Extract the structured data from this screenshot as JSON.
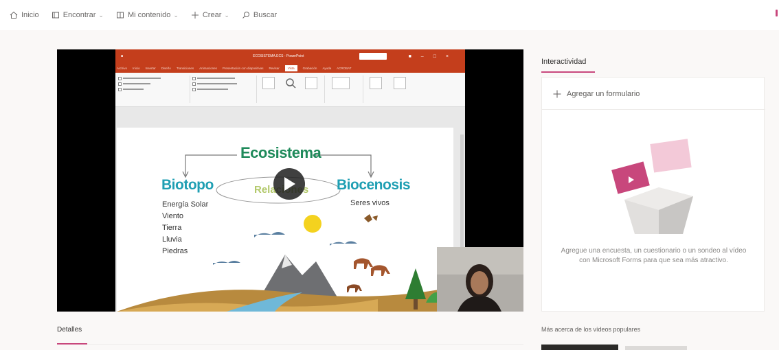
{
  "nav": {
    "home": "Inicio",
    "discover": "Encontrar",
    "my_content": "Mi contenido",
    "create": "Crear",
    "search": "Buscar"
  },
  "video": {
    "ppt_window_title": "ECOSISTEMA.ECS - PowerPoint",
    "ppt_tabs": [
      "Archivo",
      "Inicio",
      "Insertar",
      "Diseño",
      "Transiciones",
      "Animaciones",
      "Presentación con diapositivas",
      "Revisar",
      "Vista",
      "Grabación",
      "Ayuda",
      "ACROBAT"
    ],
    "ppt_active_tab": "Vista",
    "slide": {
      "title": "Ecosistema",
      "left_heading": "Biotopo",
      "center_label": "Relaciones",
      "right_heading": "Biocenosis",
      "left_items": [
        "Energía Solar",
        "Viento",
        "Tierra",
        "Lluvia",
        "Piedras"
      ],
      "right_item": "Seres vivos"
    }
  },
  "interactivity": {
    "tab_label": "Interactividad",
    "add_form": "Agregar un formulario",
    "description": "Agregue una encuesta, un cuestionario o un sondeo al vídeo con Microsoft Forms para que sea más atractivo."
  },
  "details": {
    "tab_label": "Detalles"
  },
  "popular": {
    "label": "Más acerca de los vídeos populares"
  },
  "colors": {
    "accent": "#c8477c",
    "ppt_red": "#c43e1c",
    "slide_green": "#1e8a5a",
    "slide_teal": "#1f9fb3"
  }
}
